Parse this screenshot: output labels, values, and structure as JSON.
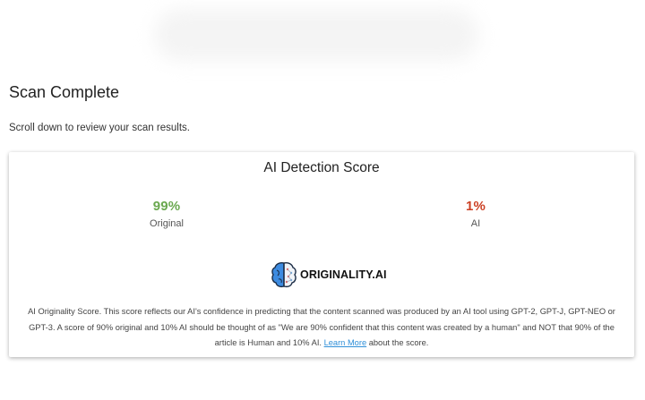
{
  "header": {
    "title": "Scan Complete",
    "subtitle": "Scroll down to review your scan results."
  },
  "card": {
    "title": "AI Detection Score",
    "scores": {
      "original": {
        "value": "99%",
        "label": "Original",
        "color": "#6aa84f"
      },
      "ai": {
        "value": "1%",
        "label": "AI",
        "color": "#cc4125"
      }
    },
    "logo": {
      "icon": "brain-icon",
      "text": "ORIGINALITY.AI"
    },
    "description": {
      "text_before": "AI Originality Score. This score reflects our AI's confidence in predicting that the content scanned was produced by an AI tool using GPT-2, GPT-J, GPT-NEO or GPT-3. A score of 90% original and 10% AI should be thought of as \"We are 90% confident that this content was created by a human\" and NOT that 90% of the article is Human and 10% AI.",
      "link_label": "Learn More",
      "text_after": "about the score."
    }
  },
  "colors": {
    "link": "#2f8fd8",
    "brain_left": "#3d8be0",
    "brain_right": "#f1f4f8"
  }
}
